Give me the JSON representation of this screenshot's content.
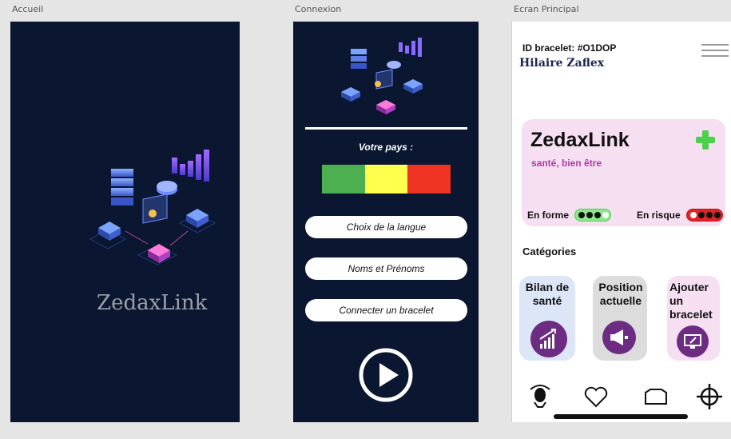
{
  "artboards": {
    "accueil": "Accueil",
    "connexion": "Connexion",
    "principal": "Ecran Principal"
  },
  "accueil": {
    "brand": "ZedaxLink"
  },
  "connexion": {
    "pays_label": "Votre pays :",
    "flag_colors": [
      "#4caf50",
      "#ffff4d",
      "#ee3322"
    ],
    "language_button": "Choix de la langue",
    "names_field": "Noms et Prénoms",
    "connect_button": "Connecter un bracelet"
  },
  "principal": {
    "id_line": "ID bracelet: #O1DOP",
    "user_name": "Hilaire Zaflex",
    "card": {
      "title": "ZedaxLink",
      "subtitle": "santé, bien être",
      "status_ok": "En forme",
      "status_risk": "En risque"
    },
    "categories_title": "Catégories",
    "tiles": [
      {
        "label": "Bilan de santé",
        "icon": "chart-growth-icon",
        "color": "#dde6f7"
      },
      {
        "label": "Position actuelle",
        "icon": "megaphone-icon",
        "color": "#dcdcdc"
      },
      {
        "label": "Ajouter un bracelet",
        "icon": "screen-edit-icon",
        "color": "#f5dff1"
      }
    ],
    "nav": [
      "profile-icon",
      "heart-icon",
      "home-icon",
      "target-icon"
    ]
  },
  "colors": {
    "dark_bg": "#0b1730",
    "accent_purple": "#6c2c82",
    "card_pink": "#f5dff1",
    "green": "#4cd14c"
  }
}
